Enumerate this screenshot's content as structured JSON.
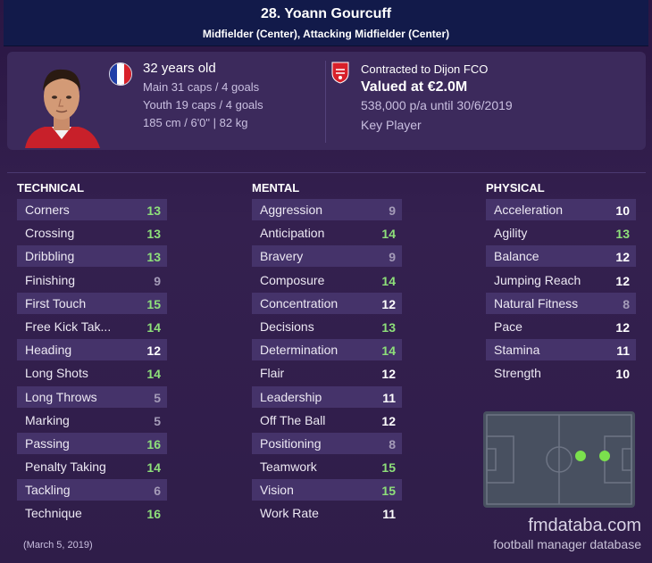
{
  "header": {
    "name": "28. Yoann Gourcuff",
    "positions": "Midfielder (Center), Attacking Midfielder (Center)"
  },
  "profile": {
    "age": "32 years old",
    "main_caps": "Main 31 caps / 4 goals",
    "youth_caps": "Youth 19 caps / 4 goals",
    "physical": "185 cm / 6'0\" | 82 kg",
    "nationality_flag": "france-flag-icon"
  },
  "contract": {
    "club_line": "Contracted to Dijon FCO",
    "value": "Valued at €2.0M",
    "wage": "538,000 p/a until 30/6/2019",
    "role": "Key Player",
    "club_badge": "dijon-badge-icon"
  },
  "technical": {
    "title": "TECHNICAL",
    "attributes": [
      {
        "label": "Corners",
        "value": "13"
      },
      {
        "label": "Crossing",
        "value": "13"
      },
      {
        "label": "Dribbling",
        "value": "13"
      },
      {
        "label": "Finishing",
        "value": "9"
      },
      {
        "label": "First Touch",
        "value": "15"
      },
      {
        "label": "Free Kick Tak...",
        "value": "14"
      },
      {
        "label": "Heading",
        "value": "12"
      },
      {
        "label": "Long Shots",
        "value": "14"
      },
      {
        "label": "Long Throws",
        "value": "5"
      },
      {
        "label": "Marking",
        "value": "5"
      },
      {
        "label": "Passing",
        "value": "16"
      },
      {
        "label": "Penalty Taking",
        "value": "14"
      },
      {
        "label": "Tackling",
        "value": "6"
      },
      {
        "label": "Technique",
        "value": "16"
      }
    ]
  },
  "mental": {
    "title": "MENTAL",
    "attributes": [
      {
        "label": "Aggression",
        "value": "9"
      },
      {
        "label": "Anticipation",
        "value": "14"
      },
      {
        "label": "Bravery",
        "value": "9"
      },
      {
        "label": "Composure",
        "value": "14"
      },
      {
        "label": "Concentration",
        "value": "12"
      },
      {
        "label": "Decisions",
        "value": "13"
      },
      {
        "label": "Determination",
        "value": "14"
      },
      {
        "label": "Flair",
        "value": "12"
      },
      {
        "label": "Leadership",
        "value": "11"
      },
      {
        "label": "Off The Ball",
        "value": "12"
      },
      {
        "label": "Positioning",
        "value": "8"
      },
      {
        "label": "Teamwork",
        "value": "15"
      },
      {
        "label": "Vision",
        "value": "15"
      },
      {
        "label": "Work Rate",
        "value": "11"
      }
    ]
  },
  "physical": {
    "title": "PHYSICAL",
    "attributes": [
      {
        "label": "Acceleration",
        "value": "10"
      },
      {
        "label": "Agility",
        "value": "13"
      },
      {
        "label": "Balance",
        "value": "12"
      },
      {
        "label": "Jumping Reach",
        "value": "12"
      },
      {
        "label": "Natural Fitness",
        "value": "8"
      },
      {
        "label": "Pace",
        "value": "12"
      },
      {
        "label": "Stamina",
        "value": "11"
      },
      {
        "label": "Strength",
        "value": "10"
      }
    ]
  },
  "footer": {
    "date": "(March 5, 2019)",
    "site": "fmdataba.com",
    "tagline": "football manager database"
  },
  "colors": {
    "header_bg": "#121a4a",
    "panel_bg": "#3c2a5c",
    "value_high": "#8ee07a",
    "value_mid": "#d8e07a",
    "value_low": "#a49bb8",
    "position_dot": "#7be04d"
  }
}
